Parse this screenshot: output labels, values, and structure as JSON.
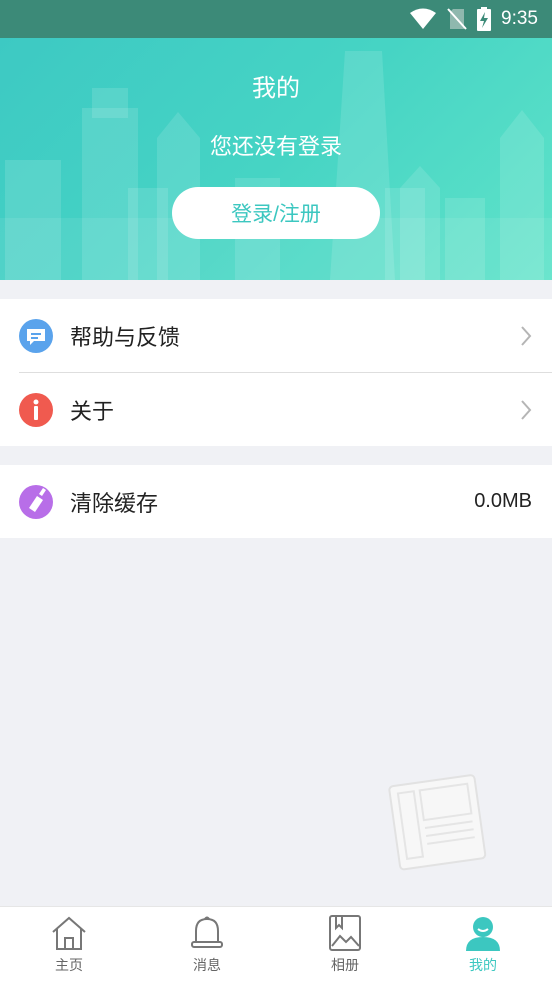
{
  "status_bar": {
    "time": "9:35"
  },
  "header": {
    "title": "我的",
    "subtitle": "您还没有登录",
    "login_button": "登录/注册"
  },
  "menu": {
    "help_label": "帮助与反馈",
    "about_label": "关于",
    "clear_cache_label": "清除缓存",
    "cache_size": "0.0MB"
  },
  "tabs": [
    {
      "label": "主页",
      "icon": "home-icon",
      "active": false
    },
    {
      "label": "消息",
      "icon": "bell-icon",
      "active": false
    },
    {
      "label": "相册",
      "icon": "album-icon",
      "active": false
    },
    {
      "label": "我的",
      "icon": "user-icon",
      "active": true
    }
  ],
  "colors": {
    "accent": "#3cc7c0",
    "status_bar": "#3c8a78",
    "help_icon": "#5aa3ec",
    "about_icon": "#f05a4f",
    "clear_icon": "#b86ee8"
  }
}
